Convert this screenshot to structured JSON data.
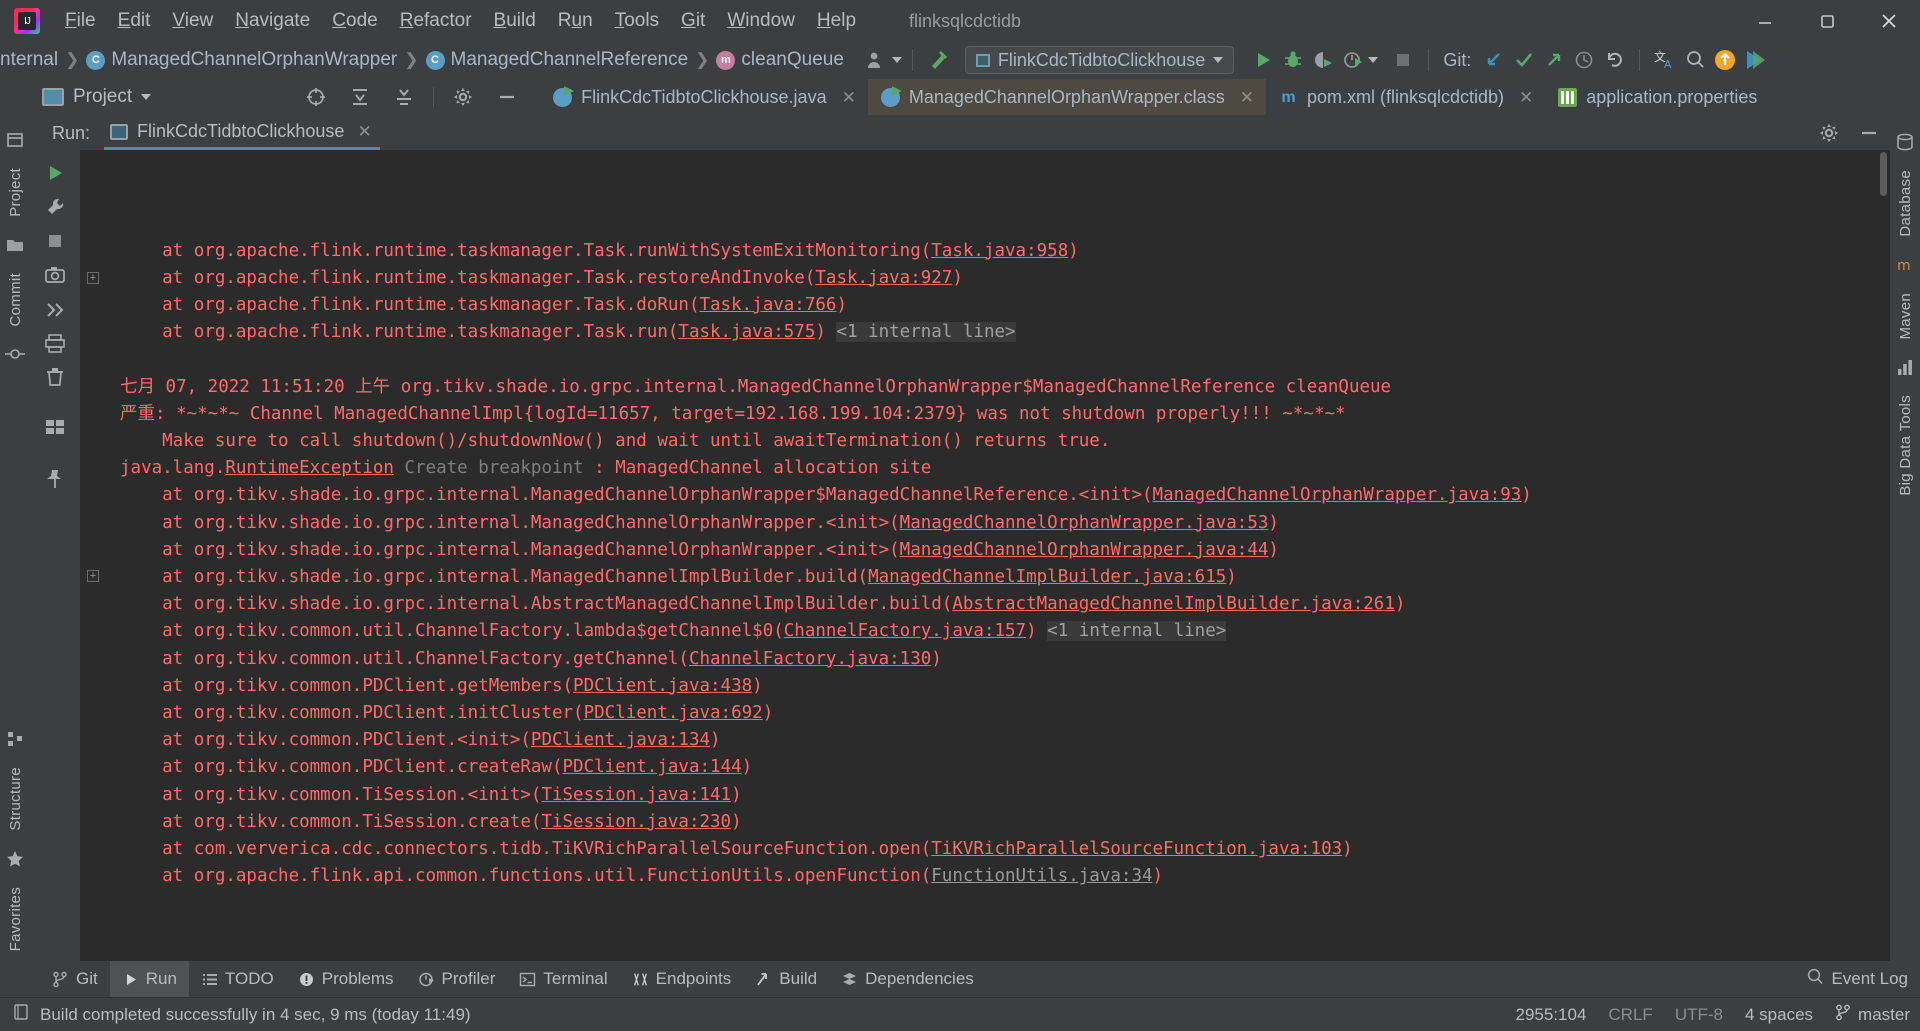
{
  "window": {
    "title": "flinksqlcdctidb",
    "controls": [
      "minimize",
      "maximize",
      "close"
    ]
  },
  "menu": {
    "items": [
      {
        "label": "File",
        "mnemonic": "F"
      },
      {
        "label": "Edit",
        "mnemonic": "E"
      },
      {
        "label": "View",
        "mnemonic": "V"
      },
      {
        "label": "Navigate",
        "mnemonic": "N"
      },
      {
        "label": "Code",
        "mnemonic": "C"
      },
      {
        "label": "Refactor",
        "mnemonic": "R"
      },
      {
        "label": "Build",
        "mnemonic": "B"
      },
      {
        "label": "Run",
        "mnemonic": "u"
      },
      {
        "label": "Tools",
        "mnemonic": "T"
      },
      {
        "label": "Git",
        "mnemonic": "G"
      },
      {
        "label": "Window",
        "mnemonic": "W"
      },
      {
        "label": "Help",
        "mnemonic": "H"
      }
    ]
  },
  "navbar": {
    "breadcrumbs": [
      {
        "label": "nternal",
        "icon": "none"
      },
      {
        "label": "ManagedChannelOrphanWrapper",
        "icon": "class-icon"
      },
      {
        "label": "ManagedChannelReference",
        "icon": "class-icon"
      },
      {
        "label": "cleanQueue",
        "icon": "method-icon"
      }
    ],
    "run_config": "FlinkCdcTidbtoClickhouse",
    "git_label": "Git:",
    "icons": [
      "user-icon",
      "build-hammer-icon",
      "run-icon",
      "debug-icon",
      "run-with-coverage-icon",
      "profiler-icon",
      "stop-icon",
      "git-update-icon",
      "git-commit-icon",
      "git-push-icon",
      "history-icon",
      "rollback-icon",
      "translate-icon",
      "search-everywhere-icon",
      "update-available-icon",
      "ide-feature-icon"
    ]
  },
  "project_toolbar": {
    "title": "Project",
    "icons": [
      "locate-icon",
      "collapse-all-icon",
      "expand-all-icon",
      "settings-gear-icon",
      "hide-icon"
    ]
  },
  "editor_tabs": [
    {
      "label": "FlinkCdcTidbtoClickhouse.java",
      "icon": "java-class-icon",
      "active": false,
      "closable": true
    },
    {
      "label": "ManagedChannelOrphanWrapper.class",
      "icon": "java-class-icon",
      "active": true,
      "closable": true
    },
    {
      "label": "pom.xml (flinksqlcdctidb)",
      "icon": "maven-xml-icon",
      "active": false,
      "closable": true
    },
    {
      "label": "application.properties",
      "icon": "properties-icon",
      "active": false,
      "closable": false
    }
  ],
  "left_rail": {
    "items": [
      {
        "label": "Project",
        "icon": "project-icon"
      },
      {
        "label": "Commit",
        "icon": "commit-icon"
      },
      {
        "label": "Structure",
        "icon": "structure-icon"
      },
      {
        "label": "Favorites",
        "icon": "favorites-star-icon"
      }
    ]
  },
  "right_rail": {
    "items": [
      {
        "label": "Database",
        "icon": "database-icon"
      },
      {
        "label": "Maven",
        "icon": "maven-m-icon"
      },
      {
        "label": "Big Data Tools",
        "icon": "bigdata-icon"
      }
    ]
  },
  "run_window": {
    "label": "Run:",
    "tab": "FlinkCdcTidbtoClickhouse",
    "tab_icon": "run-configuration-icon",
    "header_icons": [
      "settings-gear-icon",
      "hide-icon"
    ],
    "side_tools": [
      "rerun-icon",
      "wrench-icon",
      "stop-icon",
      "camera-icon",
      "thread-dump-icon",
      "export-icon",
      "up-arrow-icon",
      "down-arrow-icon",
      "soft-wrap-icon",
      "scroll-to-end-icon",
      "print-icon",
      "clear-all-icon",
      "layout-icon",
      "pin-icon"
    ]
  },
  "console": {
    "lines": [
      {
        "indent": "    ",
        "text": "at org.apache.flink.runtime.taskmanager.Task.runWithSystemExitMonitoring(",
        "link": "Task.java:958",
        "tail": ")"
      },
      {
        "indent": "    ",
        "text": "at org.apache.flink.runtime.taskmanager.Task.restoreAndInvoke(",
        "link": "Task.java:927",
        "tail": ")"
      },
      {
        "indent": "    ",
        "text": "at org.apache.flink.runtime.taskmanager.Task.doRun(",
        "link": "Task.java:766",
        "tail": ")"
      },
      {
        "indent": "    ",
        "text": "at org.apache.flink.runtime.taskmanager.Task.run(",
        "link": "Task.java:575",
        "tail": ")",
        "internal": "<1 internal line>",
        "fold": true
      },
      {
        "indent": "",
        "text": "",
        "blank": true
      },
      {
        "indent": "",
        "text": "七月 07, 2022 11:51:20 上午 org.tikv.shade.io.grpc.internal.ManagedChannelOrphanWrapper$ManagedChannelReference cleanQueue"
      },
      {
        "indent": "",
        "text": "严重: *~*~*~ Channel ManagedChannelImpl{logId=11657, target=192.168.199.104:2379} was not shutdown properly!!! ~*~*~*"
      },
      {
        "indent": "    ",
        "text": "Make sure to call shutdown()/shutdownNow() and wait until awaitTermination() returns true."
      },
      {
        "indent": "",
        "text": "java.lang.",
        "link2": "RuntimeException",
        "hint": "Create breakpoint",
        "tail2": " : ManagedChannel allocation site"
      },
      {
        "indent": "    ",
        "text": "at org.tikv.shade.io.grpc.internal.ManagedChannelOrphanWrapper$ManagedChannelReference.<init>(",
        "link": "ManagedChannelOrphanWrapper.java:93",
        "tail": ")"
      },
      {
        "indent": "    ",
        "text": "at org.tikv.shade.io.grpc.internal.ManagedChannelOrphanWrapper.<init>(",
        "link": "ManagedChannelOrphanWrapper.java:53",
        "tail": ")"
      },
      {
        "indent": "    ",
        "text": "at org.tikv.shade.io.grpc.internal.ManagedChannelOrphanWrapper.<init>(",
        "link": "ManagedChannelOrphanWrapper.java:44",
        "tail": ")"
      },
      {
        "indent": "    ",
        "text": "at org.tikv.shade.io.grpc.internal.ManagedChannelImplBuilder.build(",
        "link": "ManagedChannelImplBuilder.java:615",
        "tail": ")"
      },
      {
        "indent": "    ",
        "text": "at org.tikv.shade.io.grpc.internal.AbstractManagedChannelImplBuilder.build(",
        "link": "AbstractManagedChannelImplBuilder.java:261",
        "tail": ")"
      },
      {
        "indent": "    ",
        "text": "at org.tikv.common.util.ChannelFactory.lambda$getChannel$0(",
        "link": "ChannelFactory.java:157",
        "tail": ")",
        "internal": "<1 internal line>",
        "fold": true
      },
      {
        "indent": "    ",
        "text": "at org.tikv.common.util.ChannelFactory.getChannel(",
        "link": "ChannelFactory.java:130",
        "tail": ")"
      },
      {
        "indent": "    ",
        "text": "at org.tikv.common.PDClient.getMembers(",
        "link": "PDClient.java:438",
        "tail": ")"
      },
      {
        "indent": "    ",
        "text": "at org.tikv.common.PDClient.initCluster(",
        "link": "PDClient.java:692",
        "tail": ")"
      },
      {
        "indent": "    ",
        "text": "at org.tikv.common.PDClient.<init>(",
        "link": "PDClient.java:134",
        "tail": ")"
      },
      {
        "indent": "    ",
        "text": "at org.tikv.common.PDClient.createRaw(",
        "link": "PDClient.java:144",
        "tail": ")"
      },
      {
        "indent": "    ",
        "text": "at org.tikv.common.TiSession.<init>(",
        "link": "TiSession.java:141",
        "tail": ")"
      },
      {
        "indent": "    ",
        "text": "at org.tikv.common.TiSession.create(",
        "link": "TiSession.java:230",
        "tail": ")"
      },
      {
        "indent": "    ",
        "text": "at com.ververica.cdc.connectors.tidb.TiKVRichParallelSourceFunction.open(",
        "link": "TiKVRichParallelSourceFunction.java:103",
        "tail": ")"
      },
      {
        "indent": "    ",
        "text": "at org.apache.flink.api.common.functions.util.FunctionUtils.openFunction(",
        "link": "FunctionUtils.java:34",
        "tail": ")",
        "dimlink": true
      }
    ]
  },
  "bottom_bar": {
    "items": [
      {
        "label": "Git",
        "icon": "git-branch-icon",
        "active": false
      },
      {
        "label": "Run",
        "icon": "run-play-icon",
        "active": true
      },
      {
        "label": "TODO",
        "icon": "todo-list-icon",
        "active": false
      },
      {
        "label": "Problems",
        "icon": "problems-icon",
        "active": false
      },
      {
        "label": "Profiler",
        "icon": "profiler-icon",
        "active": false
      },
      {
        "label": "Terminal",
        "icon": "terminal-icon",
        "active": false
      },
      {
        "label": "Endpoints",
        "icon": "endpoints-icon",
        "active": false
      },
      {
        "label": "Build",
        "icon": "build-hammer-icon",
        "active": false
      },
      {
        "label": "Dependencies",
        "icon": "dependencies-icon",
        "active": false
      }
    ],
    "event_log": "Event Log",
    "event_log_icon": "event-log-icon"
  },
  "status_bar": {
    "message": "Build completed successfully in 4 sec, 9 ms (today 11:49)",
    "message_icon": "build-status-icon",
    "caret_position": "2955:104",
    "line_separator": "CRLF",
    "encoding": "UTF-8",
    "indent": "4 spaces",
    "branch": "master",
    "branch_icon": "git-branch-icon"
  },
  "colors": {
    "background": "#3c3f41",
    "console_bg": "#2b2b2b",
    "error_red": "#ff6b68",
    "accent_blue": "#4a88c7",
    "active_tab_bg": "#4e4a41",
    "text": "#bbbbbb"
  }
}
